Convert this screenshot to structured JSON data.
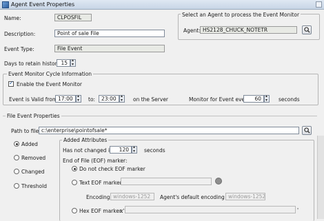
{
  "window": {
    "title": "Agent Event Properties"
  },
  "general": {
    "name_label": "Name:",
    "name_value": "CLPOSFIL",
    "description_label": "Description:",
    "description_value": "Point of sale File",
    "event_type_label": "Event Type:",
    "event_type_value": "File Event",
    "days_label": "Days to retain history:",
    "days_value": "15"
  },
  "agent_group": {
    "legend": "Select an Agent to process the Event Monitor",
    "agent_label": "Agent:",
    "agent_value": "HS2128_CHUCK_NOTETR"
  },
  "cycle": {
    "legend": "Event Monitor Cycle Information",
    "enable_label": "Enable the Event Monitor",
    "enabled": true,
    "valid_from_label": "Event is Valid from:",
    "from_value": "17:00",
    "to_label": "to:",
    "to_value": "23:00",
    "server_label": "on the Server",
    "monitor_label": "Monitor for Event every:",
    "monitor_value": "60",
    "seconds_label": "seconds"
  },
  "file_event": {
    "legend": "File Event Properties",
    "path_label": "Path to file:",
    "path_value": "c:\\enterprise\\pointofsale*",
    "modes": [
      "Added",
      "Removed",
      "Changed",
      "Threshold"
    ],
    "selected_mode": "Added"
  },
  "added": {
    "legend": "Added Attributes",
    "not_changed_label": "Has not changed in:",
    "not_changed_value": "120",
    "seconds_label": "seconds",
    "eof_label": "End of File (EOF) marker:",
    "eof_options": [
      "Do not check EOF marker",
      "Text EOF marker:",
      "Hex EOF marker:"
    ],
    "encoding_label": "Encoding:",
    "encoding_value": "windows-1252",
    "default_encoding_label": "Agent's default encoding is:",
    "default_encoding_value": "windows-1252",
    "hex_prefix": "x'",
    "hex_suffix": "'"
  }
}
